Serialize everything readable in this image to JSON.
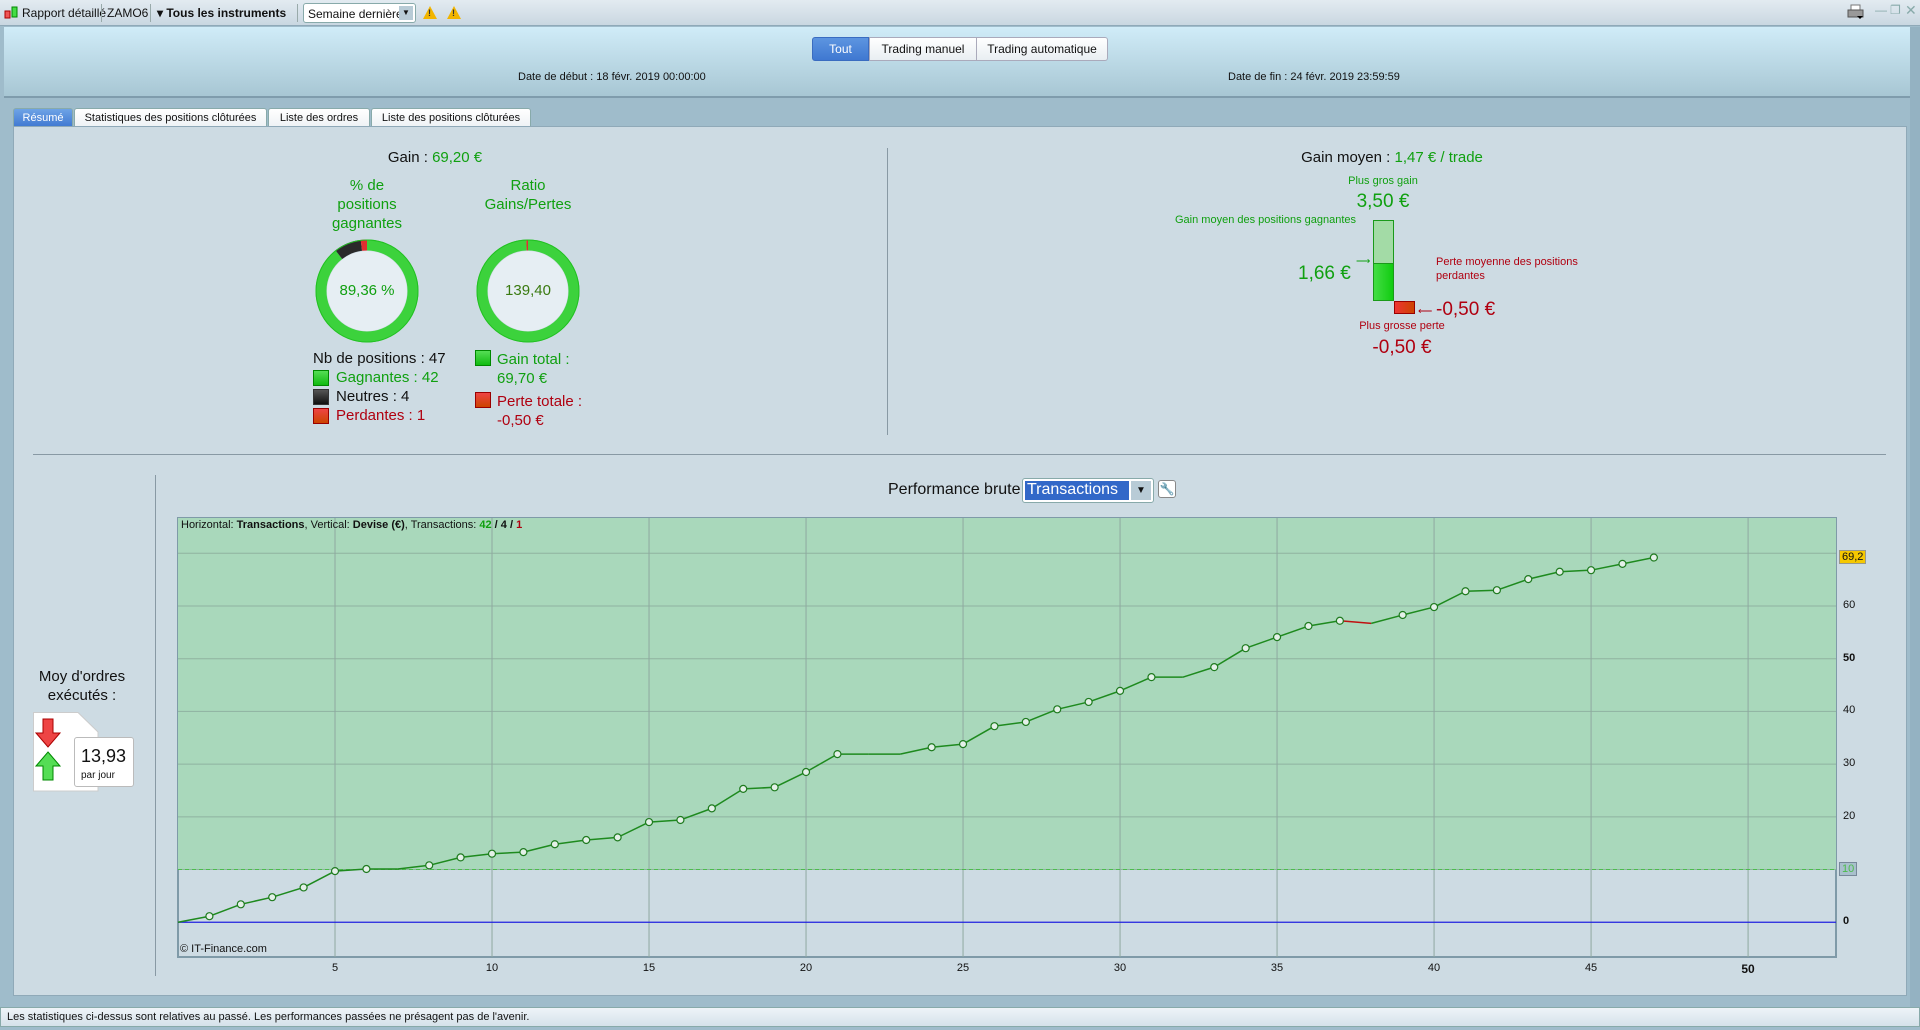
{
  "titlebar": {
    "title": "Rapport détaillé",
    "account": "ZAMO6",
    "instruments": "Tous les instruments",
    "period": "Semaine dernière",
    "icons": [
      "candlestick-icon",
      "warning-icon",
      "warning-icon",
      "print-icon",
      "minimize-icon",
      "restore-icon",
      "close-icon"
    ]
  },
  "filters": {
    "buttons": [
      "Tout",
      "Trading manuel",
      "Trading automatique"
    ],
    "active": "Tout"
  },
  "dates": {
    "start": "Date de début :  18 févr. 2019 00:00:00",
    "end": "Date de fin :  24 févr. 2019 23:59:59"
  },
  "tabs": [
    "Résumé",
    "Statistiques des positions clôturées",
    "Liste des ordres",
    "Liste des positions clôturées"
  ],
  "summary": {
    "gain_label": "Gain :",
    "gain_value": "69,20 €",
    "win_title": [
      "% de",
      "positions",
      "gagnantes"
    ],
    "win_pct": "89,36 %",
    "win_fraction": 0.8936,
    "ratio_title": [
      "Ratio",
      "Gains/Pertes"
    ],
    "ratio_value": "139,40",
    "nb_positions": "Nb de positions : 47",
    "winners": "Gagnantes : 42",
    "neutral": "Neutres : 4",
    "losers": "Perdantes : 1",
    "gain_total_label": "Gain total :",
    "gain_total": "69,70 €",
    "loss_total_label": "Perte totale :",
    "loss_total": "-0,50 €",
    "avg_label": "Gain moyen :",
    "avg_value": "1,47 € / trade",
    "max_gain_label": "Plus gros gain",
    "max_gain": "3,50 €",
    "avg_win_label": "Gain moyen des positions gagnantes",
    "avg_win": "1,66 €",
    "avg_loss_label": [
      "Perte moyenne des positions",
      "perdantes"
    ],
    "avg_loss": "-0,50 €",
    "max_loss_label": "Plus grosse perte",
    "max_loss": "-0,50 €",
    "colors": {
      "gain": "#10a010",
      "loss": "#b00010",
      "neutral": "#333333"
    }
  },
  "orders": {
    "label": [
      "Moy d'ordres",
      "exécutés :"
    ],
    "value": "13,93",
    "unit": "par jour"
  },
  "perf": {
    "label": "Performance brute",
    "select": "Transactions"
  },
  "chart_data": {
    "type": "line",
    "info": {
      "h_label": "Horizontal: ",
      "h_value": "Transactions",
      "v_label": ", Vertical: ",
      "v_value": "Devise (€)",
      "t_label": ", Transactions: ",
      "wins": "42",
      "neutral": "4",
      "losses": "1"
    },
    "copyright": "© IT-Finance.com",
    "x": [
      0,
      1,
      2,
      3,
      4,
      5,
      6,
      7,
      8,
      9,
      10,
      11,
      12,
      13,
      14,
      15,
      16,
      17,
      18,
      19,
      20,
      21,
      22,
      23,
      24,
      25,
      26,
      27,
      28,
      29,
      30,
      31,
      32,
      33,
      34,
      35,
      36,
      37,
      38,
      39,
      40,
      41,
      42,
      43,
      44,
      45,
      46,
      47
    ],
    "y": [
      0,
      1.14,
      3.4,
      4.75,
      6.6,
      9.7,
      10.1,
      10.1,
      10.8,
      12.3,
      13.0,
      13.3,
      14.8,
      15.6,
      16.1,
      19.0,
      19.4,
      21.6,
      25.3,
      25.6,
      28.5,
      31.9,
      31.9,
      31.9,
      33.2,
      33.8,
      37.2,
      38.0,
      40.4,
      41.8,
      43.9,
      46.5,
      46.5,
      48.4,
      52.0,
      54.1,
      56.2,
      57.2,
      56.7,
      58.3,
      59.8,
      62.8,
      63.0,
      65.1,
      66.5,
      66.8,
      68.0,
      69.2
    ],
    "xlim": [
      0,
      52.8
    ],
    "ylim": [
      -6.6,
      76.7
    ],
    "xticks": [
      "5",
      "10",
      "15",
      "20",
      "25",
      "30",
      "35",
      "40",
      "45",
      "50"
    ],
    "yticks": [
      "0",
      "20",
      "30",
      "40",
      "50",
      "60"
    ],
    "threshold": "10",
    "last_value": "69,2",
    "grid": true,
    "colors": {
      "line": "#1e8a1e",
      "loss_segment": "#c01010",
      "zero_line": "#2020e0",
      "zone": "#a9d8bb"
    }
  },
  "footer": "Les statistiques ci-dessus sont relatives au passé. Les performances passées ne présagent pas de l'avenir."
}
